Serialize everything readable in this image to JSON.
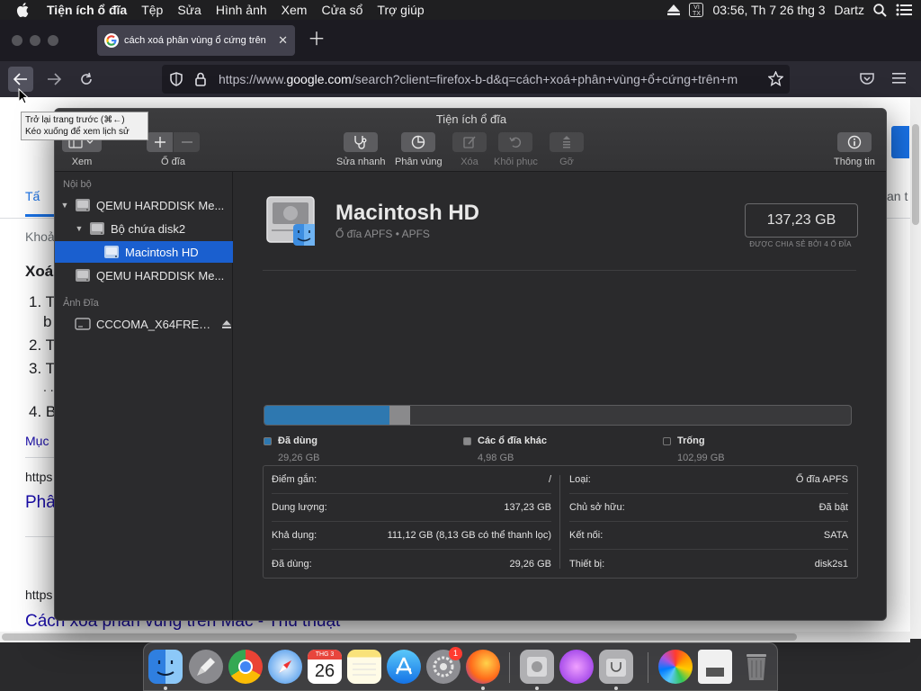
{
  "menubar": {
    "items": [
      "Tiện ích ổ đĩa",
      "Tệp",
      "Sửa",
      "Hình ảnh",
      "Xem",
      "Cửa sổ",
      "Trợ giúp"
    ],
    "input_badge": "VI TX",
    "clock": "03:56, Th 7 26 thg 3",
    "user": "Dartz"
  },
  "browser": {
    "tab_title": "cách xoá phân vùng ổ cứng trên",
    "url_prefix": "https://www.",
    "url_domain": "google.com",
    "url_rest": "/search?client=firefox-b-d&q=cách+xoá+phân+vùng+ổ+cứng+trên+m",
    "tooltip_line1": "Trở lại trang trước (⌘←)",
    "tooltip_line2": "Kéo xuống để xem lịch sử"
  },
  "google_page": {
    "frag_tab": "Tấ",
    "frag_tab_right": "an t",
    "frag_about": "Khoả",
    "frag_heading": "Xoá",
    "frag_list": [
      "1. T",
      "b",
      "2. T",
      "3. T",
      ". .",
      "4. B"
    ],
    "frag_more": "Mục",
    "frag_url1": "https",
    "frag_link1": "Phâ",
    "frag_url2": "https",
    "frag_link2": "Cách xoá phân vùng trên Mac - Thủ thuật"
  },
  "disk_utility": {
    "window_title": "Tiện ích ổ đĩa",
    "toolbar": {
      "view": "Xem",
      "volume": "Ổ đĩa",
      "first_aid": "Sửa nhanh",
      "partition": "Phân vùng",
      "erase": "Xóa",
      "restore": "Khôi phục",
      "unmount": "Gỡ",
      "info": "Thông tin"
    },
    "sidebar": {
      "section_internal": "Nội bộ",
      "disk1": "QEMU HARDDISK Me...",
      "container": "Bộ chứa disk2",
      "volume": "Macintosh HD",
      "disk2": "QEMU HARDDISK Me...",
      "section_images": "Ảnh Đĩa",
      "image": "CCCOMA_X64FRE_..."
    },
    "volume": {
      "name": "Macintosh HD",
      "subtitle": "Ổ đĩa APFS • APFS",
      "capacity": "137,23 GB",
      "capacity_note": "ĐƯỢC CHIA SẺ BỞI 4 Ổ ĐĨA"
    },
    "usage": {
      "used_label": "Đã dùng",
      "used_value": "29,26 GB",
      "other_label": "Các ổ đĩa khác",
      "other_value": "4,98 GB",
      "free_label": "Trống",
      "free_value": "102,99 GB",
      "used_fraction": 0.213,
      "other_fraction": 0.036,
      "used_color": "#2e78b0",
      "other_color": "#8a8a8c"
    },
    "info": {
      "mount_point_label": "Điểm gắn:",
      "mount_point": "/",
      "capacity_label": "Dung lượng:",
      "capacity": "137,23 GB",
      "available_label": "Khả dụng:",
      "available": "111,12 GB (8,13 GB có thể thanh lọc)",
      "used_label": "Đã dùng:",
      "used": "29,26 GB",
      "type_label": "Loại:",
      "type": "Ổ đĩa APFS",
      "owners_label": "Chủ sở hữu:",
      "owners": "Đã bật",
      "connection_label": "Kết nối:",
      "connection": "SATA",
      "device_label": "Thiết bị:",
      "device": "disk2s1"
    }
  },
  "dock": {
    "calendar_month": "THG 3",
    "calendar_day": "26",
    "system_prefs_badge": "1"
  }
}
